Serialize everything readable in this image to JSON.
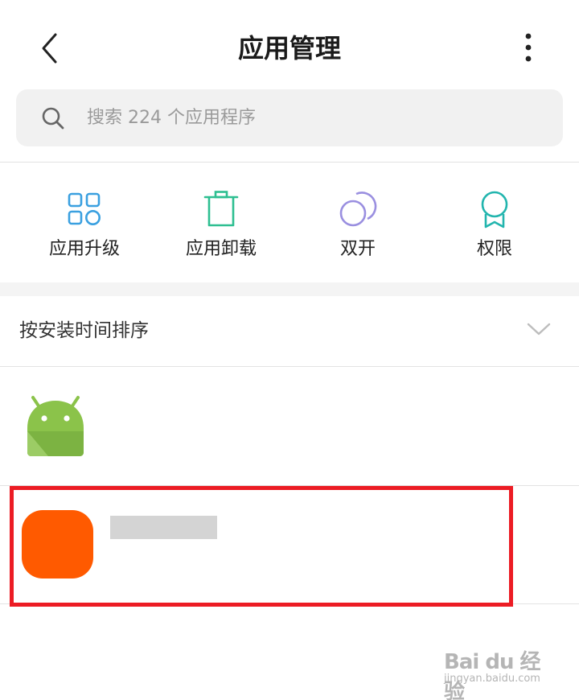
{
  "header": {
    "title": "应用管理",
    "back_icon": "chevron-left-icon",
    "more_icon": "more-vertical-icon"
  },
  "search": {
    "placeholder": "搜索 224 个应用程序",
    "value": "",
    "icon": "search-icon"
  },
  "tools": [
    {
      "label": "应用升级",
      "icon": "grid-apps-icon",
      "color": "#3aa0e0"
    },
    {
      "label": "应用卸载",
      "icon": "trash-icon",
      "color": "#2ebf91"
    },
    {
      "label": "双开",
      "icon": "dual-circles-icon",
      "color": "#9a8fe0"
    },
    {
      "label": "权限",
      "icon": "badge-icon",
      "color": "#22b5ae"
    }
  ],
  "sort": {
    "label": "按安装时间排序",
    "icon": "chevron-down-icon"
  },
  "apps": [
    {
      "icon": "android-icon",
      "icon_color": "#8bc34a"
    },
    {
      "icon": "app-orange-icon",
      "icon_color": "#ff5a00"
    }
  ],
  "highlight_color": "#ec1c24",
  "watermark": {
    "text": "Bai du 经验",
    "sub": "jingyan.baidu.com"
  }
}
